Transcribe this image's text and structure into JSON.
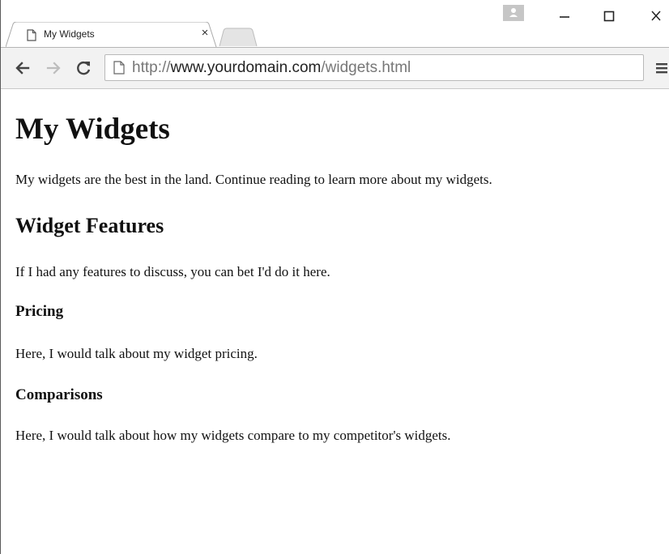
{
  "tab": {
    "title": "My Widgets",
    "close_glyph": "×",
    "favicon": "page-icon"
  },
  "window_controls": {
    "profile": "profile-icon",
    "minimize": "minimize-icon",
    "maximize": "maximize-icon",
    "close": "close-icon"
  },
  "toolbar": {
    "back": "back-arrow-icon",
    "forward": "forward-arrow-icon",
    "reload": "reload-icon",
    "menu": "hamburger-menu-icon",
    "url": {
      "scheme": "http://",
      "domain": "www.yourdomain.com",
      "path": "/widgets.html"
    }
  },
  "page": {
    "h1": "My Widgets",
    "intro": "My widgets are the best in the land. Continue reading to learn more about my widgets.",
    "features_heading": "Widget Features",
    "features_text": "If I had any features to discuss, you can bet I'd do it here.",
    "pricing_heading": "Pricing",
    "pricing_text": "Here, I would talk about my widget pricing.",
    "comparisons_heading": "Comparisons",
    "comparisons_text": "Here, I would talk about how my widgets compare to my competitor's widgets."
  }
}
